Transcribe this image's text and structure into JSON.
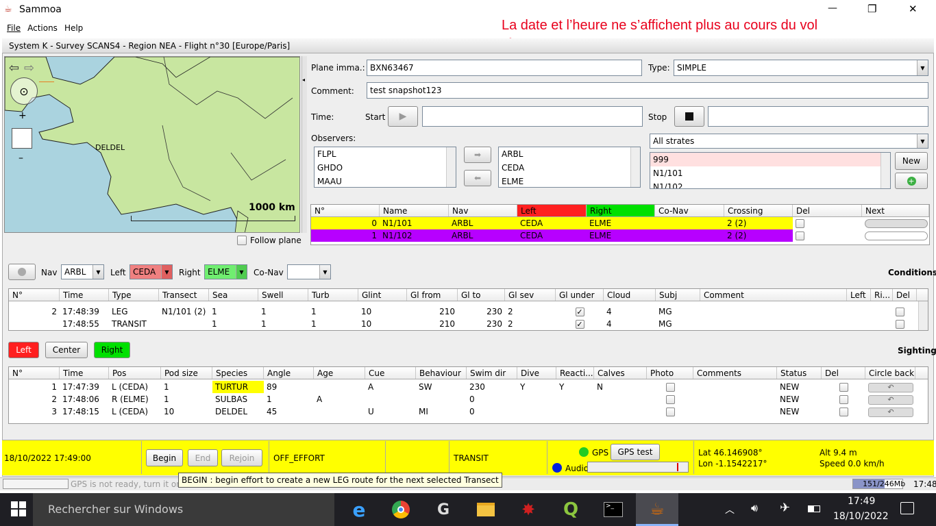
{
  "window": {
    "title": "Sammoa",
    "min": "—",
    "max": "❐",
    "close": "✕"
  },
  "menu": [
    "File",
    "Actions",
    "Help"
  ],
  "subtitle": "System K - Survey SCANS4 - Region NEA - Flight n°30 [Europe/Paris]",
  "annotation": "La date et l’heure ne s’affichent plus au cours du vol",
  "map": {
    "place_label": "DELDEL",
    "scale": "1000 km",
    "follow": "Follow plane"
  },
  "form": {
    "plane_label": "Plane imma.:",
    "plane_value": "BXN63467",
    "type_label": "Type:",
    "type_value": "SIMPLE",
    "comment_label": "Comment:",
    "comment_value": "test snapshot123",
    "time_label": "Time:",
    "start_label": "Start",
    "stop_label": "Stop",
    "observers_label": "Observers:",
    "observers_left": [
      "FLPL",
      "GHDO",
      "MAAU"
    ],
    "observers_right": [
      "ARBL",
      "CEDA",
      "ELME"
    ],
    "strates_value": "All strates",
    "strates_list": [
      "999",
      "N1/101",
      "N1/102"
    ],
    "new_button": "New"
  },
  "transects": {
    "headers": [
      "N°",
      "Name",
      "Nav",
      "Left",
      "Right",
      "Co-Nav",
      "Crossing",
      "Del",
      "Next"
    ],
    "rows": [
      [
        "0",
        "N1/101",
        "ARBL",
        "CEDA",
        "ELME",
        "",
        "2 (2)"
      ],
      [
        "1",
        "N1/102",
        "ARBL",
        "CEDA",
        "ELME",
        "",
        "2 (2)"
      ]
    ]
  },
  "conditions": {
    "nav_label": "Nav",
    "nav_value": "ARBL",
    "left_label": "Left",
    "left_value": "CEDA",
    "right_label": "Right",
    "right_value": "ELME",
    "conav_label": "Co-Nav",
    "title": "Conditions",
    "headers": [
      "N°",
      "Time",
      "Type",
      "Transect",
      "Sea",
      "Swell",
      "Turb",
      "Glint",
      "Gl from",
      "Gl to",
      "Gl sev",
      "Gl under",
      "Cloud",
      "Subj",
      "Comment",
      "Left",
      "Ri...",
      "Del"
    ],
    "rows": [
      [
        "2",
        "17:48:39",
        "LEG",
        "N1/101 (2)",
        "1",
        "1",
        "1",
        "10",
        "210",
        "230",
        "2",
        "",
        "4",
        "MG"
      ],
      [
        "",
        "17:48:55",
        "TRANSIT",
        "",
        "1",
        "1",
        "1",
        "10",
        "210",
        "230",
        "2",
        "",
        "4",
        "MG"
      ]
    ]
  },
  "sighting": {
    "left": "Left",
    "center": "Center",
    "right": "Right",
    "title": "Sighting",
    "headers": [
      "N°",
      "Time",
      "Pos",
      "Pod size",
      "Species",
      "Angle",
      "Age",
      "Cue",
      "Behaviour",
      "Swim dir",
      "Dive",
      "Reacti...",
      "Calves",
      "Photo",
      "Comments",
      "Status",
      "Del",
      "Circle back"
    ],
    "rows": [
      [
        "1",
        "17:47:39",
        "L (CEDA)",
        "1",
        "TURTUR",
        "89",
        "",
        "A",
        "SW",
        "230",
        "Y",
        "Y",
        "N",
        "",
        "",
        "NEW"
      ],
      [
        "2",
        "17:48:06",
        "R (ELME)",
        "1",
        "SULBAS",
        "1",
        "A",
        "",
        "",
        "0",
        "",
        "",
        "",
        "",
        "",
        "NEW"
      ],
      [
        "3",
        "17:48:15",
        "L (CEDA)",
        "10",
        "DELDEL",
        "45",
        "",
        "U",
        "MI",
        "0",
        "",
        "",
        "",
        "",
        "",
        "NEW"
      ]
    ]
  },
  "status": {
    "datetime": "18/10/2022 17:49:00",
    "begin": "Begin",
    "end": "End",
    "rejoin": "Rejoin",
    "effort": "OFF_EFFORT",
    "route": "TRANSIT",
    "gps_label": "GPS",
    "gps_test": "GPS test",
    "audio_label": "Audio",
    "lat": "Lat 46.146908°",
    "lon": "Lon -1.1542217°",
    "alt": "Alt 9.4 m",
    "speed": "Speed 0.0 km/h"
  },
  "tooltip": "BEGIN : begin effort to create a new LEG route for the next selected Transect",
  "bottom": {
    "gps_msg": "GPS is not ready, turn it on or",
    "memory": "151/246Mb",
    "time": "17:48"
  },
  "taskbar": {
    "search": "Rechercher sur Windows",
    "time": "17:49",
    "date": "18/10/2022"
  },
  "colors": {
    "yellow": "#ffff00",
    "purple": "#b700ff",
    "red": "#ff2020",
    "green": "#00e000",
    "annotation": "#e8001c"
  }
}
